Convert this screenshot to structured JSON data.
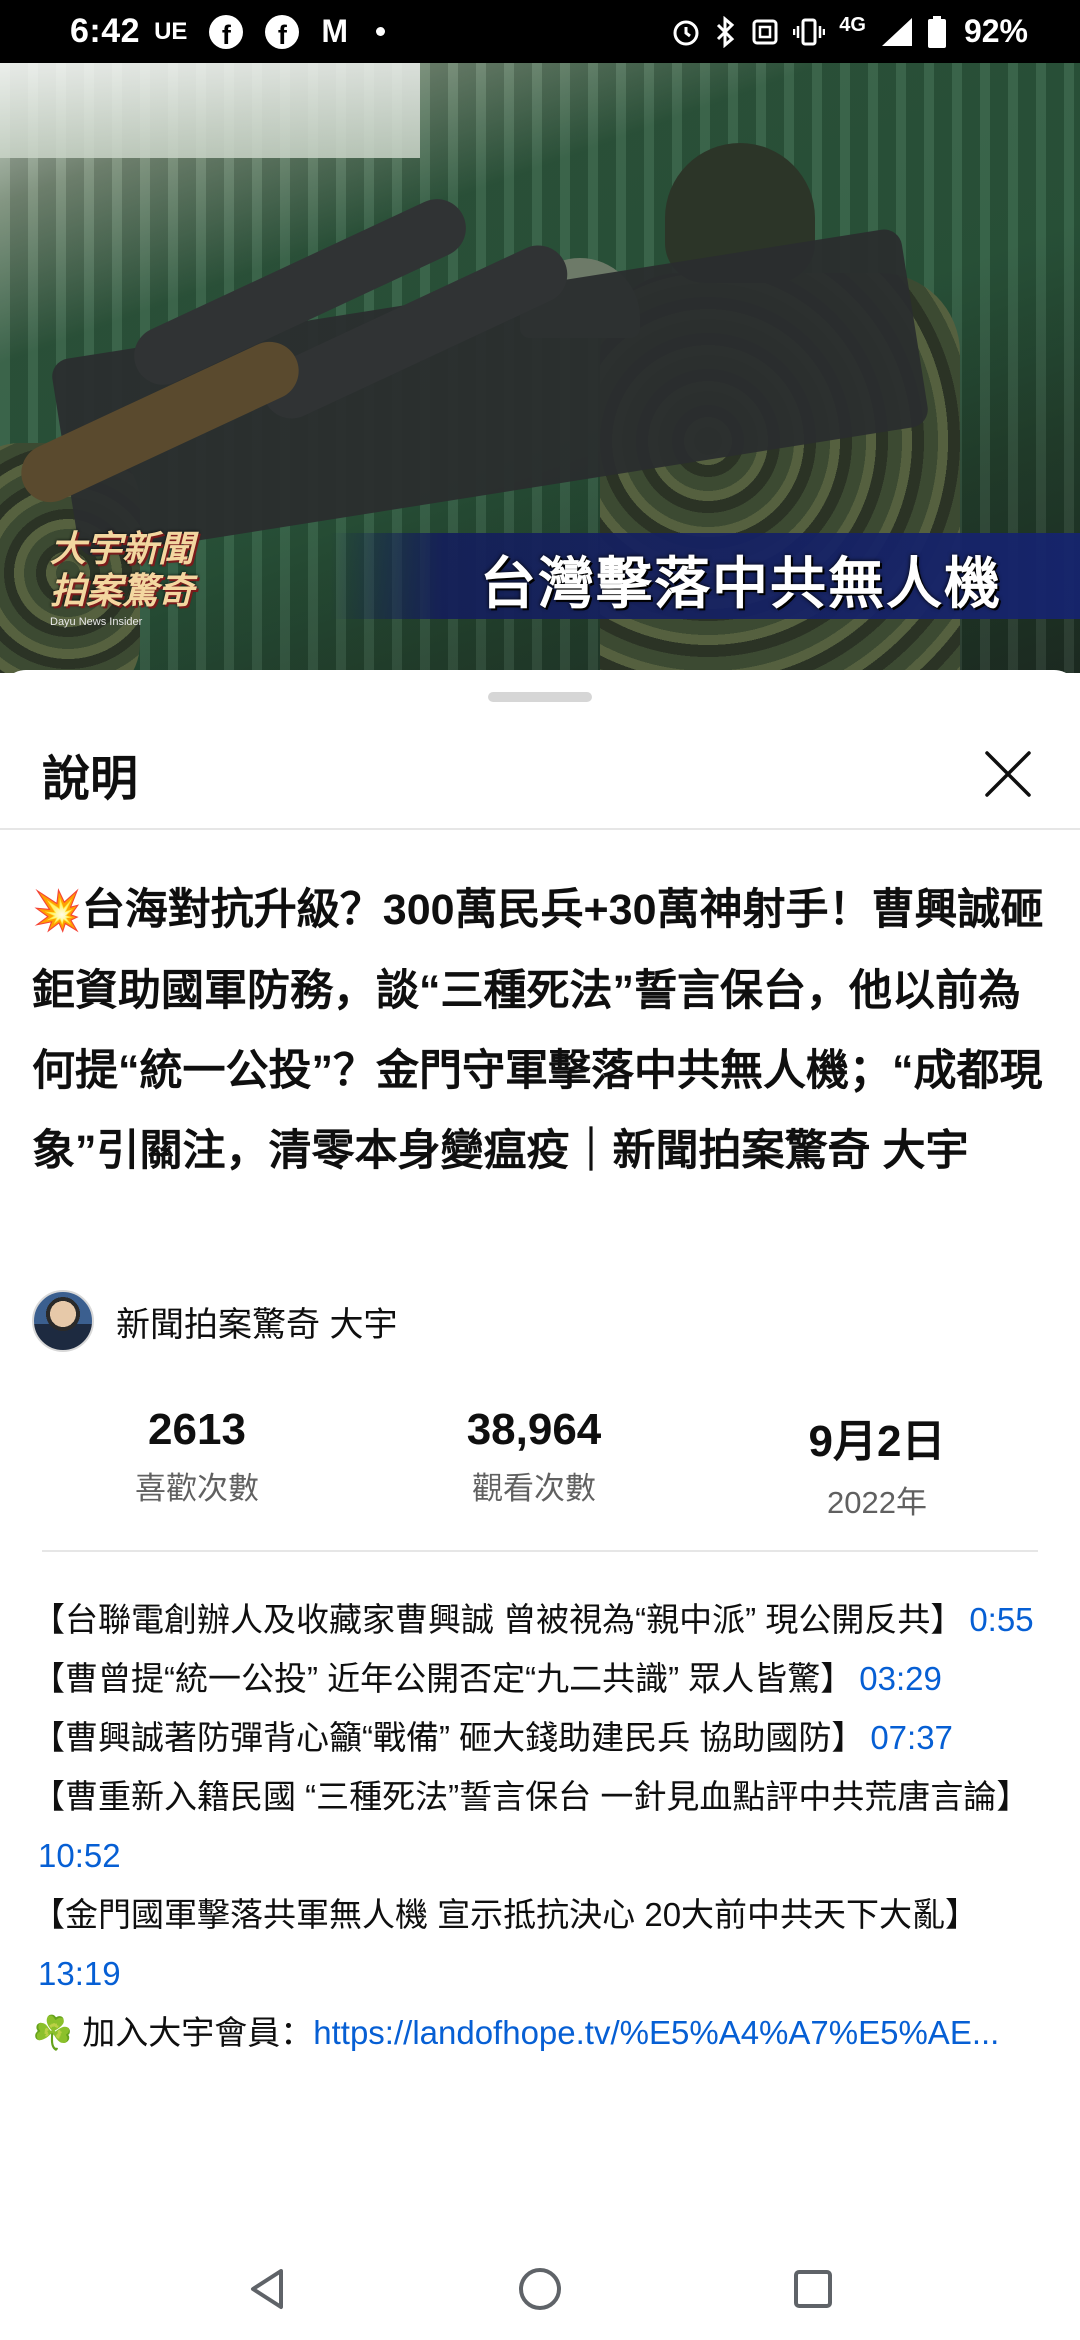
{
  "status_bar": {
    "time": "6:42",
    "carrier": "UE",
    "network": "4G",
    "battery": "92%",
    "icons": [
      "facebook-icon",
      "facebook-icon",
      "gmail-icon",
      "notification-dot-icon",
      "alarm-icon",
      "bluetooth-icon",
      "nfc-icon",
      "vibrate-icon",
      "signal-icon",
      "battery-icon"
    ]
  },
  "video": {
    "overlay_caption": "台灣擊落中共無人機",
    "logo_line1": "大宇新聞",
    "logo_line2": "拍案驚奇",
    "logo_sub": "Dayu News Insider",
    "progress": 0.01
  },
  "sheet": {
    "header_title": "說明",
    "title_emoji": "💥",
    "title_text": "台海對抗升級？300萬民兵+30萬神射手！曹興誠砸鉅資助國軍防務，談“三種死法”誓言保台，他以前為何提“統一公投”？金門守軍擊落中共無人機；“成都現象”引關注，清零本身變瘟疫｜新聞拍案驚奇 大宇",
    "channel_name": "新聞拍案驚奇 大宇",
    "stats": [
      {
        "value": "2613",
        "label": "喜歡次數"
      },
      {
        "value": "38,964",
        "label": "觀看次數"
      },
      {
        "value": "9月2日",
        "label": "2022年"
      }
    ],
    "description": [
      {
        "text": "【台聯電創辦人及收藏家曹興誠 曾被視為“親中派” 現公開反共】",
        "timestamp": "0:55"
      },
      {
        "text": "【曹曾提“統一公投” 近年公開否定“九二共識” 眾人皆驚】",
        "timestamp": "03:29"
      },
      {
        "text": "【曹興誠著防彈背心籲“戰備” 砸大錢助建民兵 協助國防】",
        "timestamp": "07:37"
      },
      {
        "text": "【曹重新入籍民國 “三種死法”誓言保台 一針見血點評中共荒唐言論】",
        "timestamp": "10:52"
      },
      {
        "text": "【金門國軍擊落共軍無人機 宣示抵抗決心 20大前中共天下大亂】",
        "timestamp": "13:19"
      }
    ],
    "member_emoji": "☘️",
    "member_label": "加入大宇會員：",
    "member_link": "https://landofhope.tv/%E5%A4%A7%E5%AE..."
  },
  "nav_bar": {
    "buttons": [
      "back-icon",
      "home-icon",
      "recents-icon"
    ]
  },
  "colors": {
    "link": "#065fd4",
    "secondary_text": "#606060",
    "progress": "#ff0000"
  }
}
